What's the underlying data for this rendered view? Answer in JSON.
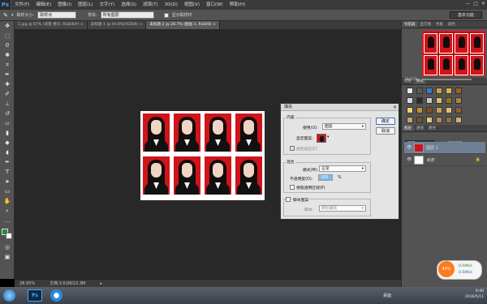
{
  "app": {
    "logo": "Ps"
  },
  "menubar": {
    "items": [
      "文件(F)",
      "编辑(E)",
      "图像(I)",
      "图层(L)",
      "文字(Y)",
      "选择(S)",
      "滤镜(T)",
      "3D(D)",
      "视图(V)",
      "窗口(W)",
      "帮助(H)"
    ],
    "window_controls": [
      "—",
      "□",
      "✕"
    ]
  },
  "options_bar": {
    "sample_size_label": "取样大小:",
    "sample_size_value": "取样点",
    "sample_label": "样本:",
    "sample_value": "所有图层",
    "show_ring_label": "显示取样环",
    "workspace": "基本功能"
  },
  "tabs": [
    {
      "label": "1.jpg @ 67% (背景 拷贝, RGB/8#) ×",
      "active": false
    },
    {
      "label": "未标题-1 @ 44.8%(RGB/8) ×",
      "active": false
    },
    {
      "label": "未标题-2 @ 28.7% (图层 1, RGB/8) ×",
      "active": true
    }
  ],
  "status_bar": {
    "zoom": "28.65%",
    "doc_size": "文档:3.61M/22.3M"
  },
  "right_panel": {
    "nav_tabs": [
      "导航器",
      "直方图",
      "色板",
      "颜色"
    ],
    "nav_zoom": "28.65%",
    "adj_tabs": [
      "调整",
      "样式"
    ],
    "layer_tabs": [
      "图层",
      "通道",
      "路径"
    ],
    "blend_mode": "正常",
    "opacity_label": "不透明度:",
    "lock_label": "锁定:",
    "fill_label": "填充:",
    "layers": [
      {
        "name": "图层 1",
        "selected": true
      },
      {
        "name": "背景",
        "selected": false
      }
    ],
    "colors": {
      "accent_red": "#d0141b"
    }
  },
  "dialog": {
    "title": "填充",
    "content_group": "内容",
    "use_label": "使用(U):",
    "use_value": "图案",
    "custom_pattern_label": "自定图案:",
    "color_adapt_label": "颜色适应(C)",
    "blend_group": "混合",
    "mode_label": "模式(M):",
    "mode_value": "正常",
    "opacity_label": "不透明度(O):",
    "opacity_value": "100",
    "opacity_unit": "%",
    "preserve_label": "保留透明区域(P)",
    "script_label": "脚本图案",
    "script_field_label": "脚本:",
    "script_value": "砖形填充",
    "ok_label": "确定",
    "cancel_label": "取消"
  },
  "taskbar": {
    "clock_time": "9:40",
    "clock_date": "2016/5/11",
    "desktop_label": "桌面",
    "net_up": "0.04K/s",
    "net_down": "0.04K/s",
    "net_percent": "49%"
  }
}
